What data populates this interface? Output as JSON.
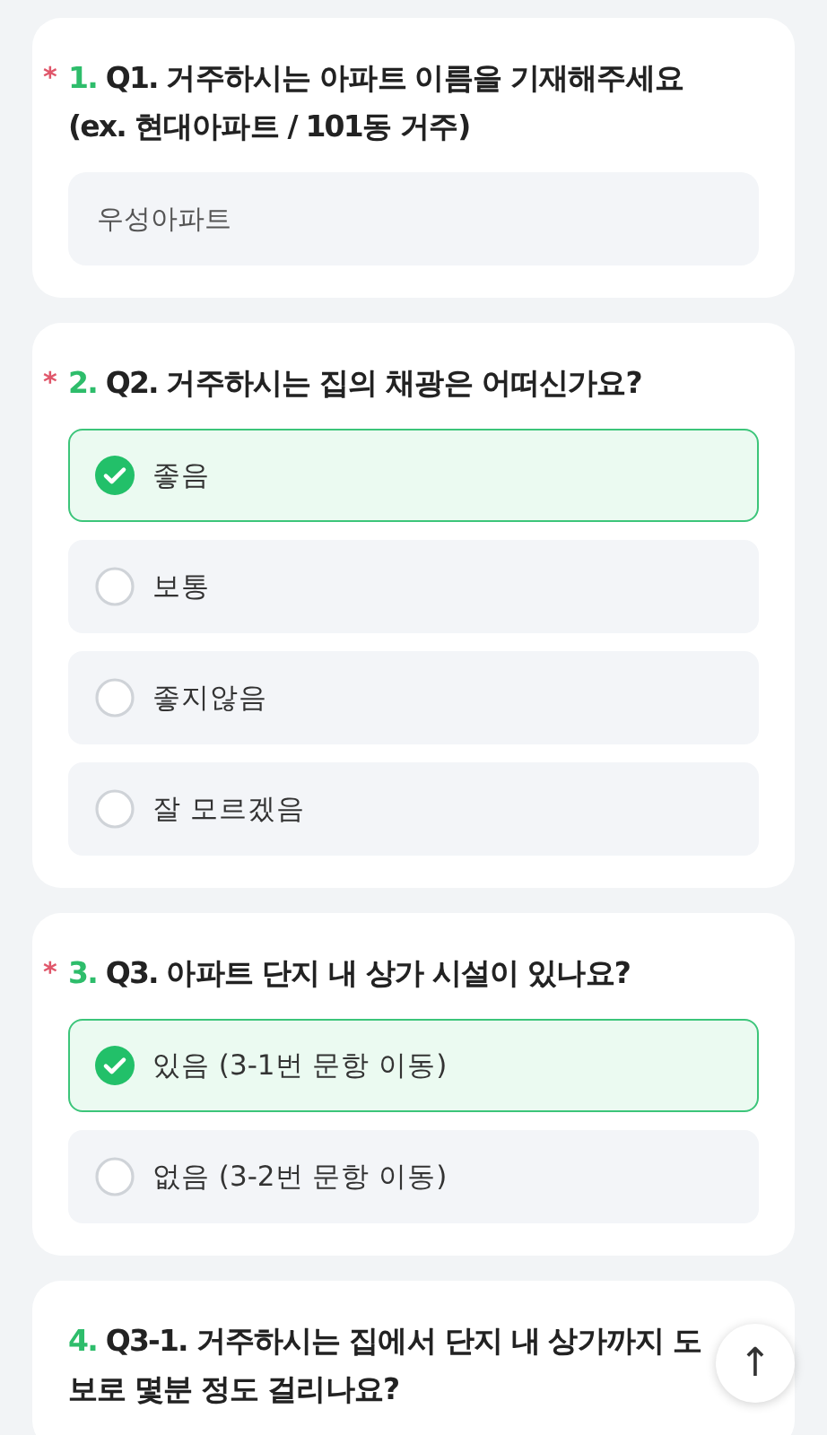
{
  "questions": [
    {
      "required_mark": "*",
      "number": "1.",
      "title": "Q1. 거주하시는 아파트 이름을 기재해주세요 (ex. 현대아파트 / 101동 거주)",
      "kind": "text",
      "value": "우성아파트"
    },
    {
      "required_mark": "*",
      "number": "2.",
      "title": "Q2. 거주하시는 집의 채광은 어떠신가요?",
      "kind": "choice",
      "options": [
        {
          "label": "좋음",
          "selected": true
        },
        {
          "label": "보통",
          "selected": false
        },
        {
          "label": "좋지않음",
          "selected": false
        },
        {
          "label": "잘 모르겠음",
          "selected": false
        }
      ]
    },
    {
      "required_mark": "*",
      "number": "3.",
      "title": "Q3. 아파트 단지 내 상가 시설이 있나요?",
      "kind": "choice",
      "options": [
        {
          "label": "있음 (3-1번 문항 이동)",
          "selected": true
        },
        {
          "label": "없음 (3-2번 문항 이동)",
          "selected": false
        }
      ]
    },
    {
      "number": "4.",
      "title": "Q3-1. 거주하시는 집에서 단지 내 상가까지 도보로 몇분 정도 걸리나요?",
      "kind": "choice"
    }
  ],
  "scroll_top_button": {
    "icon": "↑"
  }
}
